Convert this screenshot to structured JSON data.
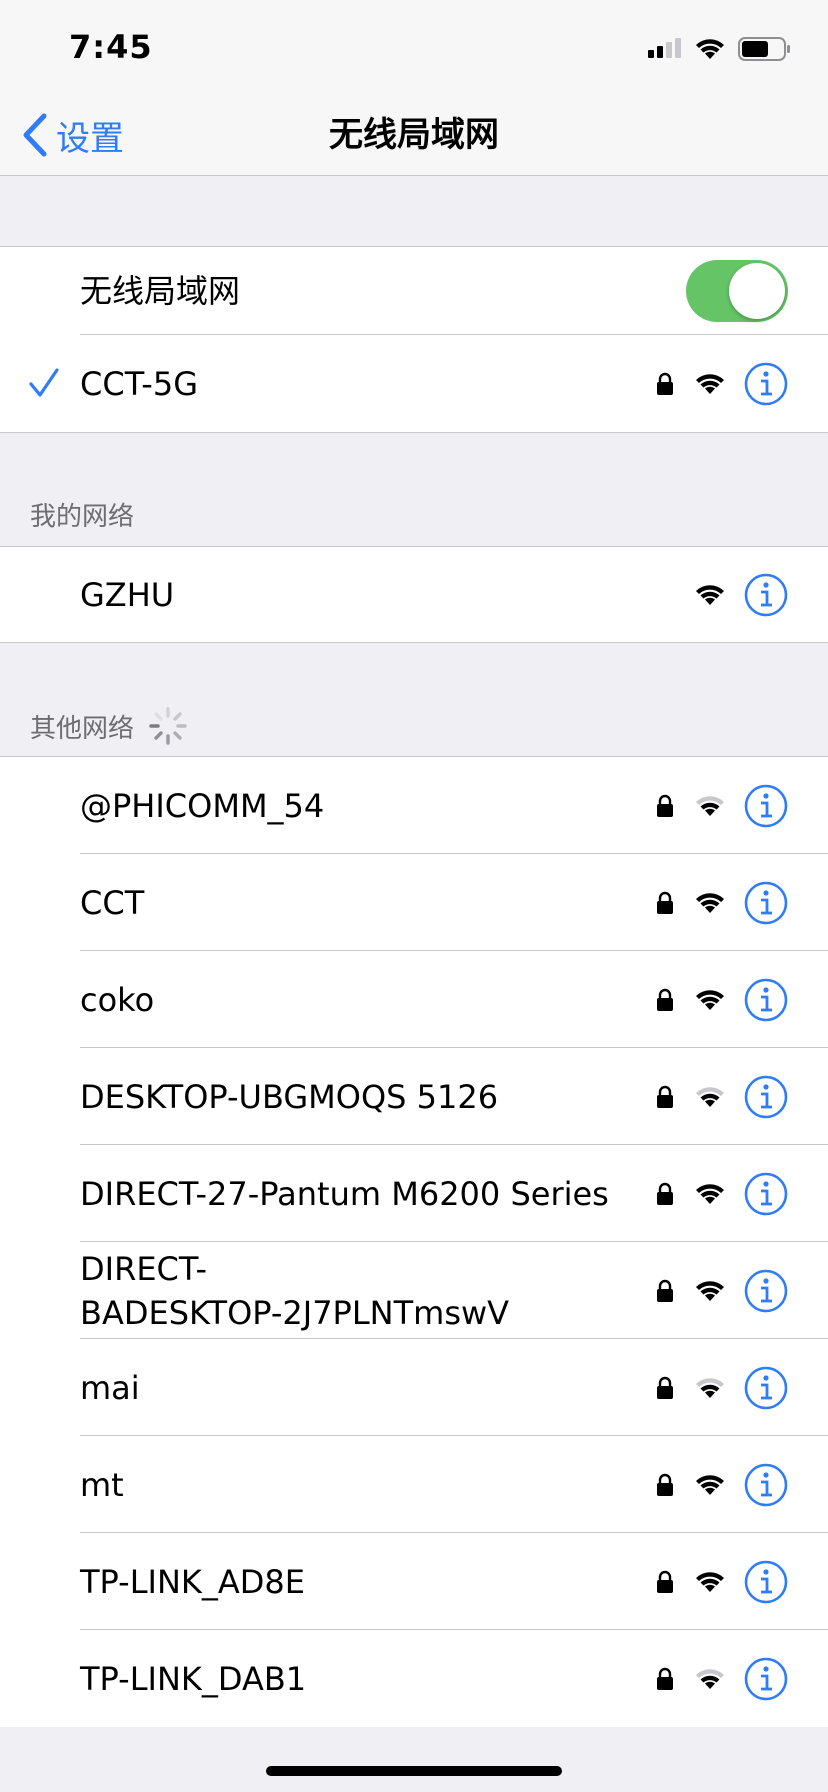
{
  "status_bar": {
    "time": "7:45"
  },
  "nav": {
    "back_label": "设置",
    "title": "无线局域网"
  },
  "wlan_toggle": {
    "label": "无线局域网",
    "on": true
  },
  "connected": {
    "name": "CCT-5G",
    "locked": true,
    "signal": "full"
  },
  "my_networks": {
    "header": "我的网络",
    "items": [
      {
        "name": "GZHU",
        "locked": false,
        "signal": "full"
      }
    ]
  },
  "other_networks": {
    "header": "其他网络",
    "items": [
      {
        "name": "@PHICOMM_54",
        "locked": true,
        "signal": "weak"
      },
      {
        "name": "CCT",
        "locked": true,
        "signal": "full"
      },
      {
        "name": "coko",
        "locked": true,
        "signal": "full"
      },
      {
        "name": "DESKTOP-UBGMOQS 5126",
        "locked": true,
        "signal": "weak"
      },
      {
        "name": "DIRECT-27-Pantum M6200 Series",
        "locked": true,
        "signal": "full"
      },
      {
        "name": "DIRECT-BADESKTOP-2J7PLNTmswV",
        "locked": true,
        "signal": "full"
      },
      {
        "name": "mai",
        "locked": true,
        "signal": "weak"
      },
      {
        "name": "mt",
        "locked": true,
        "signal": "full"
      },
      {
        "name": "TP-LINK_AD8E",
        "locked": true,
        "signal": "full"
      },
      {
        "name": "TP-LINK_DAB1",
        "locked": true,
        "signal": "weak"
      }
    ]
  },
  "colors": {
    "accent": "#2f7cf6",
    "toggle_on": "#65c466",
    "background": "#efeff4"
  }
}
